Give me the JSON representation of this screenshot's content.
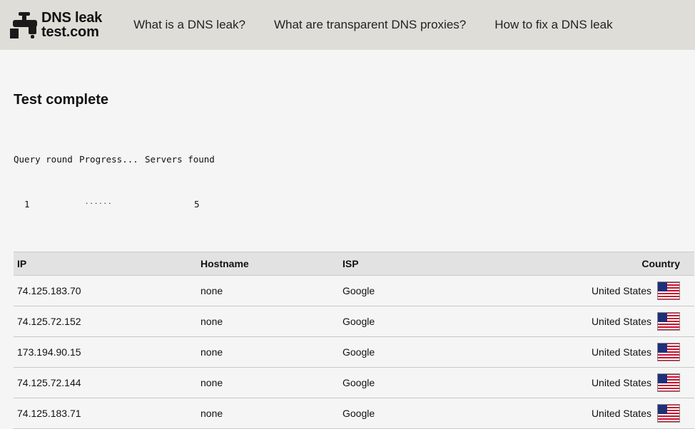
{
  "header": {
    "logo": {
      "line1": "DNS leak",
      "line2": "test.com",
      "icon": "faucet-icon"
    },
    "nav": [
      "What is a DNS leak?",
      "What are transparent DNS proxies?",
      "How to fix a DNS leak"
    ]
  },
  "main": {
    "title": "Test complete",
    "progress": {
      "col_query_round": "Query round",
      "col_progress": "Progress...",
      "col_servers_found": "Servers found",
      "query_round": "1",
      "progress_dots": "......",
      "servers_found": "5"
    },
    "table": {
      "headers": {
        "ip": "IP",
        "hostname": "Hostname",
        "isp": "ISP",
        "country": "Country"
      },
      "rows": [
        {
          "ip": "74.125.183.70",
          "hostname": "none",
          "isp": "Google",
          "country": "United States"
        },
        {
          "ip": "74.125.72.152",
          "hostname": "none",
          "isp": "Google",
          "country": "United States"
        },
        {
          "ip": "173.194.90.15",
          "hostname": "none",
          "isp": "Google",
          "country": "United States"
        },
        {
          "ip": "74.125.72.144",
          "hostname": "none",
          "isp": "Google",
          "country": "United States"
        },
        {
          "ip": "74.125.183.71",
          "hostname": "none",
          "isp": "Google",
          "country": "United States"
        }
      ]
    }
  },
  "colors": {
    "header_bg": "#deddd8",
    "page_bg": "#f5f5f5",
    "table_head_bg": "#e2e2e2"
  },
  "icons": {
    "flag": "us-flag-icon"
  }
}
